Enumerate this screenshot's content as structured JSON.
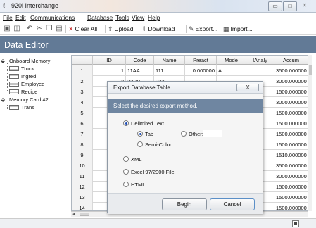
{
  "window": {
    "title": "920i Interchange",
    "icon": "app-logo-icon"
  },
  "menu": [
    {
      "label": "File"
    },
    {
      "label": "Edit"
    },
    {
      "label": "Communications"
    },
    {
      "label": "Database"
    },
    {
      "label": "Tools"
    },
    {
      "label": "View"
    },
    {
      "label": "Help"
    }
  ],
  "toolbar": {
    "clear_all": "Clear All",
    "upload": "Upload",
    "download": "Download",
    "export": "Export...",
    "import": "Import..."
  },
  "editor": {
    "title": "Data Editor"
  },
  "tree": {
    "root1": "Onboard Memory",
    "children1": [
      "Truck",
      "Ingred",
      "Employee",
      "Recipe"
    ],
    "root2": "Memory Card #2",
    "children2": [
      "Trans"
    ]
  },
  "grid": {
    "headers": [
      "",
      "ID",
      "Code",
      "Name",
      "Preact",
      "Mode",
      "IAnaly",
      "Accum"
    ],
    "rows": [
      {
        "n": "1",
        "id": "1",
        "code": "11AA",
        "name": "111",
        "preact": "0.000000",
        "mode": "A",
        "ianaly": "",
        "accum": "3500.000000"
      },
      {
        "n": "2",
        "id": "2",
        "code": "22BB",
        "name": "222",
        "preact": "",
        "mode": "",
        "ianaly": "",
        "accum": "3000.000000"
      },
      {
        "n": "3",
        "id": "",
        "code": "",
        "name": "",
        "preact": "",
        "mode": "",
        "ianaly": "",
        "accum": "1500.000000"
      },
      {
        "n": "4",
        "id": "",
        "code": "",
        "name": "",
        "preact": "",
        "mode": "",
        "ianaly": "",
        "accum": "3000.000000"
      },
      {
        "n": "5",
        "id": "",
        "code": "",
        "name": "",
        "preact": "",
        "mode": "",
        "ianaly": "",
        "accum": "1500.000000"
      },
      {
        "n": "6",
        "id": "",
        "code": "",
        "name": "",
        "preact": "",
        "mode": "",
        "ianaly": "",
        "accum": "1500.000000"
      },
      {
        "n": "7",
        "id": "",
        "code": "",
        "name": "",
        "preact": "",
        "mode": "",
        "ianaly": "",
        "accum": "1500.000000"
      },
      {
        "n": "8",
        "id": "",
        "code": "",
        "name": "",
        "preact": "",
        "mode": "",
        "ianaly": "",
        "accum": "1500.000000"
      },
      {
        "n": "9",
        "id": "",
        "code": "",
        "name": "",
        "preact": "",
        "mode": "",
        "ianaly": "",
        "accum": "1510.000000"
      },
      {
        "n": "10",
        "id": "",
        "code": "",
        "name": "",
        "preact": "",
        "mode": "",
        "ianaly": "",
        "accum": "3500.000000"
      },
      {
        "n": "11",
        "id": "",
        "code": "",
        "name": "",
        "preact": "",
        "mode": "",
        "ianaly": "",
        "accum": "3000.000000"
      },
      {
        "n": "12",
        "id": "",
        "code": "",
        "name": "",
        "preact": "",
        "mode": "",
        "ianaly": "",
        "accum": "1500.000000"
      },
      {
        "n": "13",
        "id": "",
        "code": "",
        "name": "",
        "preact": "",
        "mode": "",
        "ianaly": "",
        "accum": "1500.000000"
      },
      {
        "n": "14",
        "id": "",
        "code": "",
        "name": "",
        "preact": "",
        "mode": "",
        "ianaly": "",
        "accum": "1500.000000"
      }
    ]
  },
  "dialog": {
    "title": "Export Database Table",
    "close": "X",
    "banner": "Select the desired export method.",
    "delimited": "Delimited Text",
    "tab": "Tab",
    "other": "Other:",
    "other_value": "",
    "semicolon": "Semi-Colon",
    "xml": "XML",
    "excel": "Excel 97/2000 File",
    "html": "HTML",
    "begin": "Begin",
    "cancel": "Cancel",
    "selected_method": "Delimited Text",
    "selected_delimiter": "Tab"
  },
  "colors": {
    "editor_bar": "#627a96",
    "banner": "#6f86a1",
    "radio_selected": "#1f4fb8"
  }
}
